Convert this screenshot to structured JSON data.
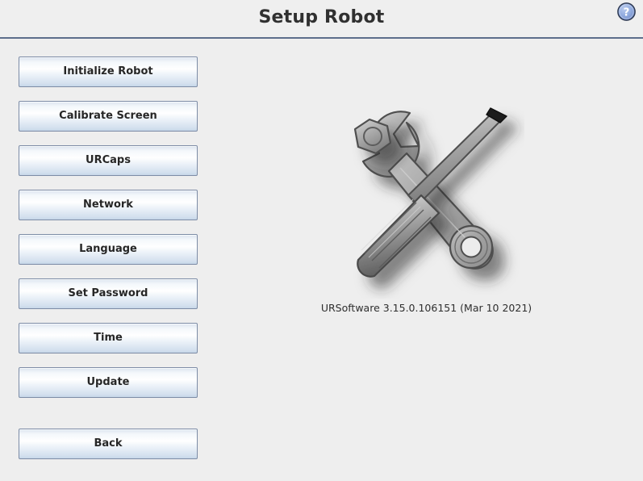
{
  "header": {
    "title": "Setup Robot",
    "help_icon": "question-mark-circle-icon",
    "help_glyph": "?",
    "rule_color": "#5d6e8c"
  },
  "sidebar": {
    "buttons": [
      {
        "label": "Initialize Robot",
        "name": "initialize-robot-button"
      },
      {
        "label": "Calibrate Screen",
        "name": "calibrate-screen-button"
      },
      {
        "label": "URCaps",
        "name": "urcaps-button"
      },
      {
        "label": "Network",
        "name": "network-button"
      },
      {
        "label": "Language",
        "name": "language-button"
      },
      {
        "label": "Set Password",
        "name": "set-password-button"
      },
      {
        "label": "Time",
        "name": "time-button"
      },
      {
        "label": "Update",
        "name": "update-button"
      },
      {
        "label": "Back",
        "name": "back-button"
      }
    ]
  },
  "main": {
    "illustration": "wrench-and-screwdriver-icon",
    "version_text": "URSoftware 3.15.0.106151 (Mar 10 2021)"
  },
  "colors": {
    "background": "#eeeeee",
    "button_border": "#7d8ca6",
    "button_text": "#262626",
    "title_text": "#303030",
    "accent_rule": "#5d6e8c",
    "help_circle_fill": "#7d98d4",
    "tool_metal_light": "#b6b6b6",
    "tool_metal_mid": "#9a9a9a",
    "tool_metal_dark": "#6e6e6e",
    "tool_outline": "#4a4a4a"
  }
}
